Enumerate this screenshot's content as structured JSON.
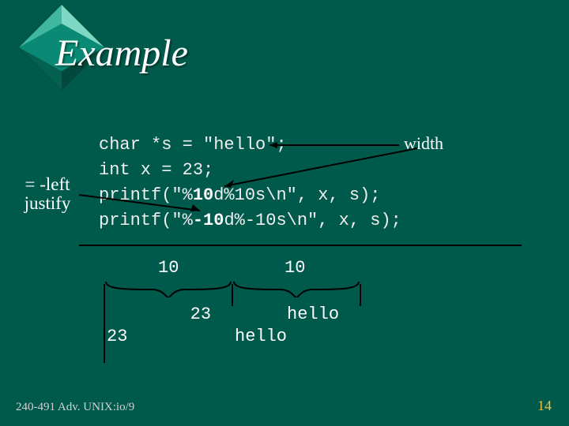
{
  "title": "Example",
  "code": {
    "l1_a": "char *s = ",
    "l1_b": "\"hello\"",
    "l1_c": ";",
    "l2": "int x = 23;",
    "l3_a": "printf(\"%",
    "l3_b": "10",
    "l3_c": "d%10s\\n\", x, s);",
    "l4_a": "printf(\"%",
    "l4_b": "-10",
    "l4_c": "d%-10s\\n\", x, s);"
  },
  "anno": {
    "left": "= -left justify",
    "width": "width"
  },
  "widths": {
    "a": "10",
    "b": "10"
  },
  "output": {
    "r1a": "        23",
    "r1b": "     hello",
    "r2a": "23",
    "r2b": "hello"
  },
  "footer": {
    "left": "240-491 Adv. UNIX:io/9",
    "right": "14"
  }
}
